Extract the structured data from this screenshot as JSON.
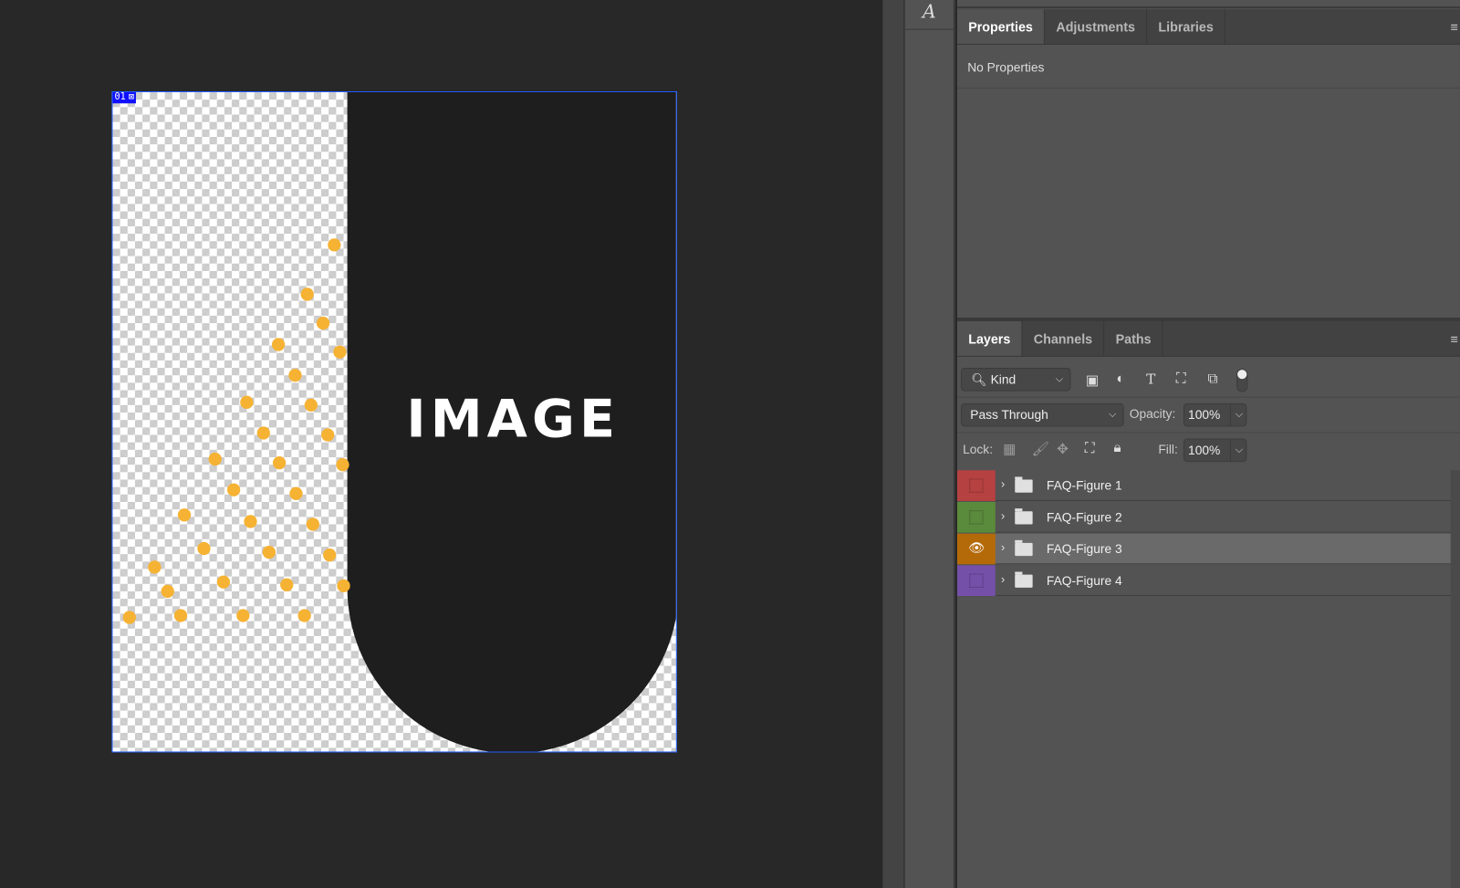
{
  "canvas": {
    "badge_number": "01",
    "badge_icon": "image-icon",
    "placeholder_text": "IMAGE",
    "dot_color": "#f6b233"
  },
  "dock": {
    "icon": "character-A-icon"
  },
  "properties_panel": {
    "tabs": [
      {
        "label": "Properties",
        "active": true
      },
      {
        "label": "Adjustments"
      },
      {
        "label": "Libraries"
      }
    ],
    "content": "No Properties"
  },
  "layers_panel": {
    "tabs": [
      {
        "label": "Layers",
        "active": true
      },
      {
        "label": "Channels"
      },
      {
        "label": "Paths"
      }
    ],
    "filter": {
      "value": "Kind"
    },
    "blend_mode": "Pass Through",
    "opacity_label": "Opacity:",
    "opacity": "100%",
    "lock_label": "Lock:",
    "fill_label": "Fill:",
    "fill": "100%",
    "layers": [
      {
        "name": "FAQ-Figure 1",
        "color": "#b64141",
        "visible": false
      },
      {
        "name": "FAQ-Figure 2",
        "color": "#5a8a3c",
        "visible": false
      },
      {
        "name": "FAQ-Figure 3",
        "color": "#b56a0a",
        "visible": true,
        "selected": true
      },
      {
        "name": "FAQ-Figure 4",
        "color": "#7450a8",
        "visible": false
      }
    ]
  }
}
